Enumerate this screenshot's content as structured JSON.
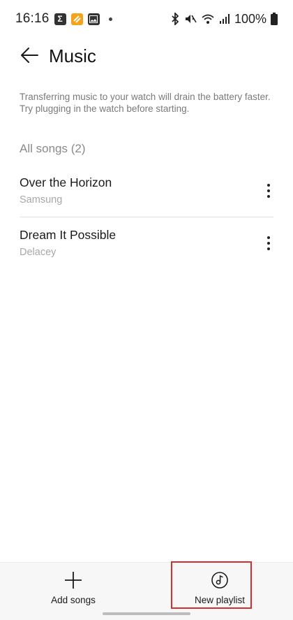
{
  "status_bar": {
    "time": "16:16",
    "notification_icons": [
      "sigma-icon",
      "orange-app-icon",
      "gallery-icon",
      "dot-icon"
    ],
    "system_icons": [
      "bluetooth-icon",
      "mute-icon",
      "wifi-icon",
      "signal-icon",
      "battery-icon"
    ],
    "battery": "100%"
  },
  "header": {
    "title": "Music"
  },
  "info": {
    "text": "Transferring music to your watch will drain the battery faster. Try plugging in the watch before starting."
  },
  "songs": {
    "header": "All songs (2)",
    "items": [
      {
        "title": "Over the Horizon",
        "artist": "Samsung"
      },
      {
        "title": "Dream It Possible",
        "artist": "Delacey"
      }
    ]
  },
  "bottom_bar": {
    "add_label": "Add songs",
    "playlist_label": "New playlist"
  },
  "colors": {
    "highlight": "#d32f2f",
    "secondary_text": "#a8a8a8"
  }
}
